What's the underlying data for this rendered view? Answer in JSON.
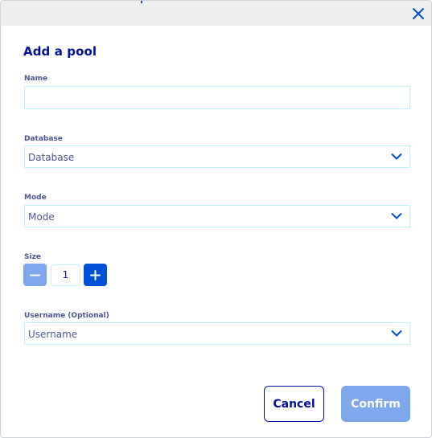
{
  "dialog": {
    "title": "Add a pool"
  },
  "icons": {
    "close": "close-icon",
    "chevron": "chevron-down-icon",
    "minus": "minus-icon",
    "plus": "plus-icon"
  },
  "form": {
    "name": {
      "label": "Name",
      "value": "",
      "placeholder": ""
    },
    "database": {
      "label": "Database",
      "selected": "Database"
    },
    "mode": {
      "label": "Mode",
      "selected": "Mode"
    },
    "size": {
      "label": "Size",
      "value": "1"
    },
    "username": {
      "label": "Username (Optional)",
      "selected": "Username"
    }
  },
  "actions": {
    "cancel_label": "Cancel",
    "confirm_label": "Confirm"
  },
  "colors": {
    "primary": "#0050d7",
    "primary_disabled": "#7fa7ec",
    "heading": "#000e9c",
    "label": "#4d5693",
    "field_border": "#bef1ff",
    "topbar": "#eeeeee"
  }
}
